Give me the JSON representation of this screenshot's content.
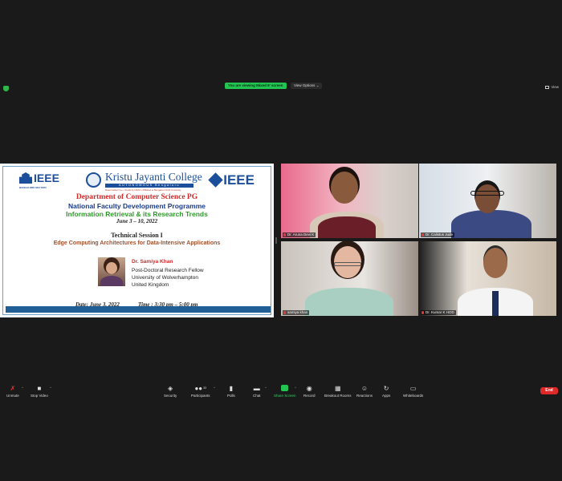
{
  "top_bar": {
    "banner": "You are viewing Mixed 9' screen",
    "view_options": "View Options",
    "view_label": "View"
  },
  "slide": {
    "left_logo": "IEEE",
    "left_logo_sub": "BANGALORE SECTION",
    "college_name": "Kristu Jayanti College",
    "college_autonomous": "AUTONOMOUS Bengaluru",
    "college_accreditation": "Reaccredited 'A++' Grade by NAAC | Affiliated to Bengaluru North University",
    "right_logo": "IEEE",
    "department": "Department of Computer Science PG",
    "programme": "National Faculty Development Programme",
    "topic": "Information Retrieval & its Research Trends",
    "dates": "June 3 – 10, 2022",
    "session": "Technical Session I",
    "session_title": "Edge Computing Architectures for  Data-Intensive Applications",
    "speaker_name": "Dr. Samiya Khan",
    "speaker_role": "Post-Doctoral Research Fellow",
    "speaker_univ": "University of Wolverhampton",
    "speaker_country": "United Kingdom",
    "date_line": "Date: June 3, 2022",
    "time_line": "Time : 3:30 pm – 5:00 pm"
  },
  "participants": [
    {
      "name": "Dr. Aruna Devi K"
    },
    {
      "name": "Dr. Calistus Jude"
    },
    {
      "name": "samiya khan"
    },
    {
      "name": "Dr. Kumar K HOD"
    }
  ],
  "toolbar": {
    "unmute": "Unmute",
    "stop_video": "Stop Video",
    "security": "Security",
    "participants": "Participants",
    "participants_count": "33",
    "polls": "Polls",
    "chat": "Chat",
    "share_screen": "Share Screen",
    "record": "Record",
    "breakout_rooms": "Breakout Rooms",
    "reactions": "Reactions",
    "apps": "Apps",
    "whiteboards": "Whiteboards",
    "end": "End"
  },
  "colors": {
    "share_green": "#23c552",
    "end_red": "#e02828",
    "background": "#1a1a1a"
  }
}
